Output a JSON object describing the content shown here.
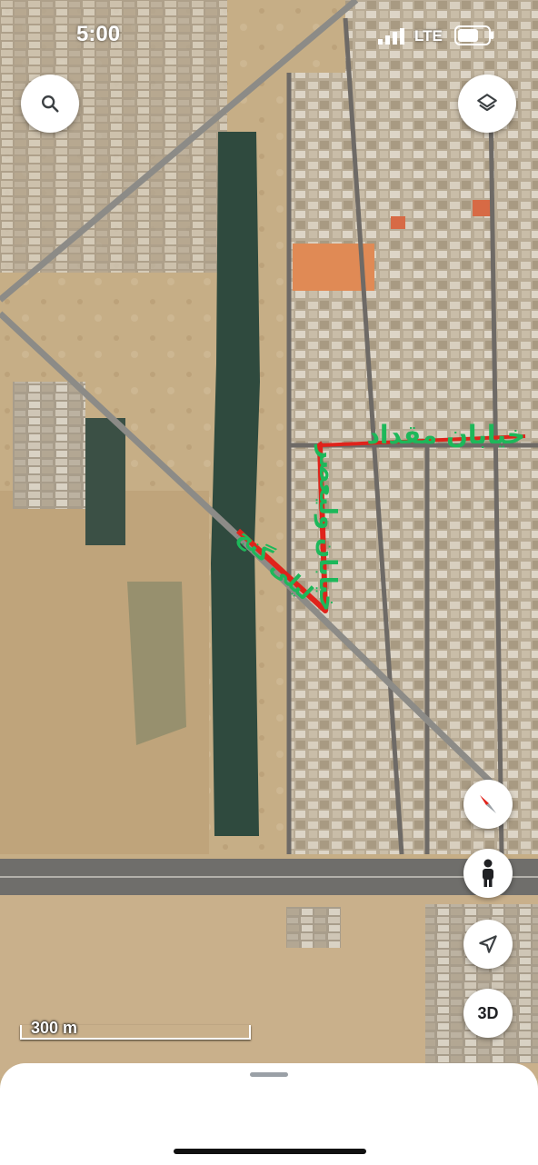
{
  "status_bar": {
    "time": "5:00",
    "network": "LTE",
    "signal_icon": "cellular-signal-icon",
    "battery_icon": "battery-icon"
  },
  "map": {
    "view": "satellite",
    "annotations": [
      {
        "text": "خیابان مقداد",
        "color": "#1db85a"
      },
      {
        "text": "خیابان ولیعصر",
        "color": "#1db85a"
      },
      {
        "text": "لیلی گنج",
        "color": "#1db85a"
      }
    ],
    "route_color": "#e0231b",
    "scale_label": "300 m"
  },
  "controls": {
    "search_icon": "search-icon",
    "layers_icon": "layers-icon",
    "compass_icon": "compass-icon",
    "street_view_icon": "pegman-icon",
    "location_icon": "navigation-arrow-icon",
    "three_d_label": "3D"
  }
}
